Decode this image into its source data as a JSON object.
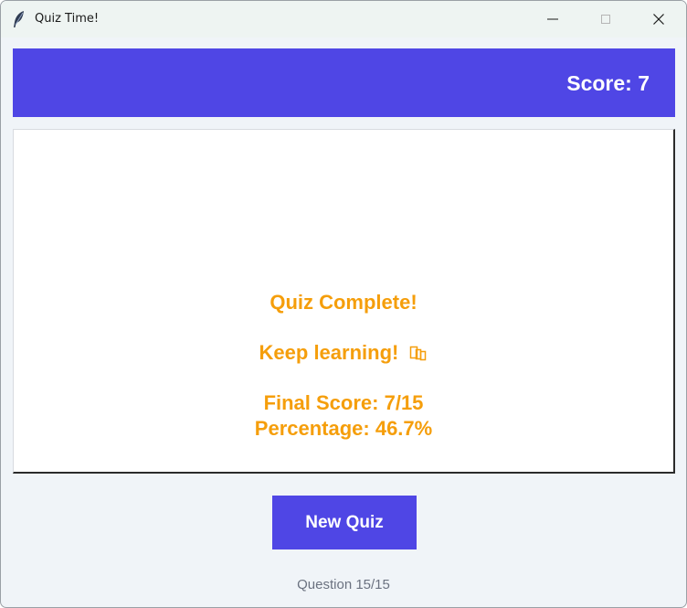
{
  "window": {
    "title": "Quiz Time!",
    "icon": "feather-icon",
    "controls": [
      "minimize-icon",
      "maximize-icon",
      "close-icon"
    ]
  },
  "header": {
    "score_text": "Score: 7"
  },
  "result": {
    "heading": "Quiz Complete!",
    "message": "Keep learning!",
    "message_icon": "books-icon",
    "final_score": "Final Score: 7/15",
    "percentage": "Percentage: 46.7%"
  },
  "actions": {
    "new_quiz_label": "New Quiz"
  },
  "footer": {
    "progress_text": "Question 15/15"
  },
  "colors": {
    "accent": "#4f46e5",
    "result_text": "#f59e0b",
    "background": "#f0f4f8",
    "muted_text": "#6b7280"
  }
}
